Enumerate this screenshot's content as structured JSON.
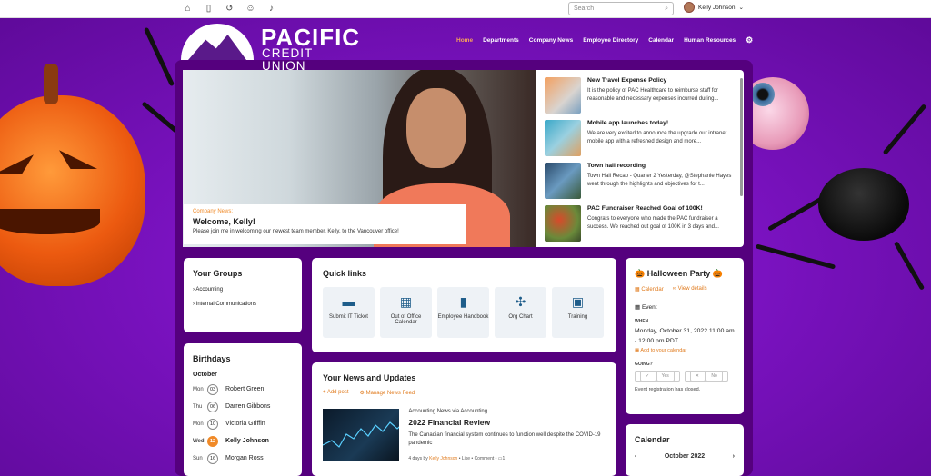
{
  "topbar": {
    "icons": [
      "home-icon",
      "bookmark-icon",
      "history-icon",
      "people-icon",
      "bell-icon"
    ],
    "search_placeholder": "Search",
    "user_name": "Kelly Johnson"
  },
  "brand": {
    "name": "PACIFIC",
    "sub": "CREDIT UNION"
  },
  "nav": {
    "items": [
      "Home",
      "Departments",
      "Company News",
      "Employee Directory",
      "Calendar",
      "Human Resources"
    ]
  },
  "hero": {
    "tag": "Company News",
    "title": "Welcome, Kelly!",
    "desc": "Please join me in welcoming our newest team member, Kelly, to the Vancouver office!"
  },
  "news": [
    {
      "title": "New Travel Expense Policy",
      "desc": "It is the policy of PAC Healthcare to reimburse staff for reasonable and necessary expenses incurred during..."
    },
    {
      "title": "Mobile app launches today!",
      "desc": "We are very excited to announce the upgrade our intranet mobile app with a refreshed design and more..."
    },
    {
      "title": "Town hall recording",
      "desc": "Town Hall Recap - Quarter 2 Yesterday, @Stephanie Hayes went through the highlights and objectives for t..."
    },
    {
      "title": "PAC Fundraiser Reached Goal of 100K!",
      "desc": "Congrats to everyone who made the PAC fundraiser a success. We reached out goal of 100K in 3 days and..."
    }
  ],
  "groups": {
    "title": "Your Groups",
    "items": [
      "Accounting",
      "Internal Communications"
    ]
  },
  "birthdays": {
    "title": "Birthdays",
    "month": "October",
    "rows": [
      {
        "dow": "Mon",
        "day": "03",
        "name": "Robert Green"
      },
      {
        "dow": "Thu",
        "day": "06",
        "name": "Darren Gibbons"
      },
      {
        "dow": "Mon",
        "day": "10",
        "name": "Victoria Griffin"
      },
      {
        "dow": "Wed",
        "day": "12",
        "name": "Kelly Johnson"
      },
      {
        "dow": "Sun",
        "day": "16",
        "name": "Morgan Ross"
      }
    ]
  },
  "quicklinks": {
    "title": "Quick links",
    "items": [
      "Submit IT Ticket",
      "Out of Office Calendar",
      "Employee Handbook",
      "Org Chart",
      "Training"
    ]
  },
  "yournews": {
    "title": "Your News and Updates",
    "add_post": "Add post",
    "manage": "Manage News Feed",
    "post": {
      "source": "Accounting News via Accounting",
      "title": "2022 Financial Review",
      "desc": "The Canadian financial system continues to function well despite the COVID-19 pandemic",
      "meta_prefix": "4 days by",
      "author": "Kelly Johnson",
      "like": "Like",
      "comment": "Comment",
      "comment_count": "1"
    }
  },
  "event": {
    "title": "Halloween Party",
    "calendar_link": "Calendar",
    "details_link": "View details",
    "type": "Event",
    "when_label": "WHEN",
    "when": "Monday, October 31, 2022 11:00 am - 12:00 pm PDT",
    "add_calendar": "Add to your calendar",
    "going_label": "GOING?",
    "yes": "Yes",
    "no": "No",
    "closed": "Event registration has closed."
  },
  "calendar": {
    "title": "Calendar",
    "month": "October 2022"
  },
  "colors": {
    "accent": "#f08a28",
    "brand_purple": "#55007e",
    "link_blue": "#1e5d8a"
  }
}
